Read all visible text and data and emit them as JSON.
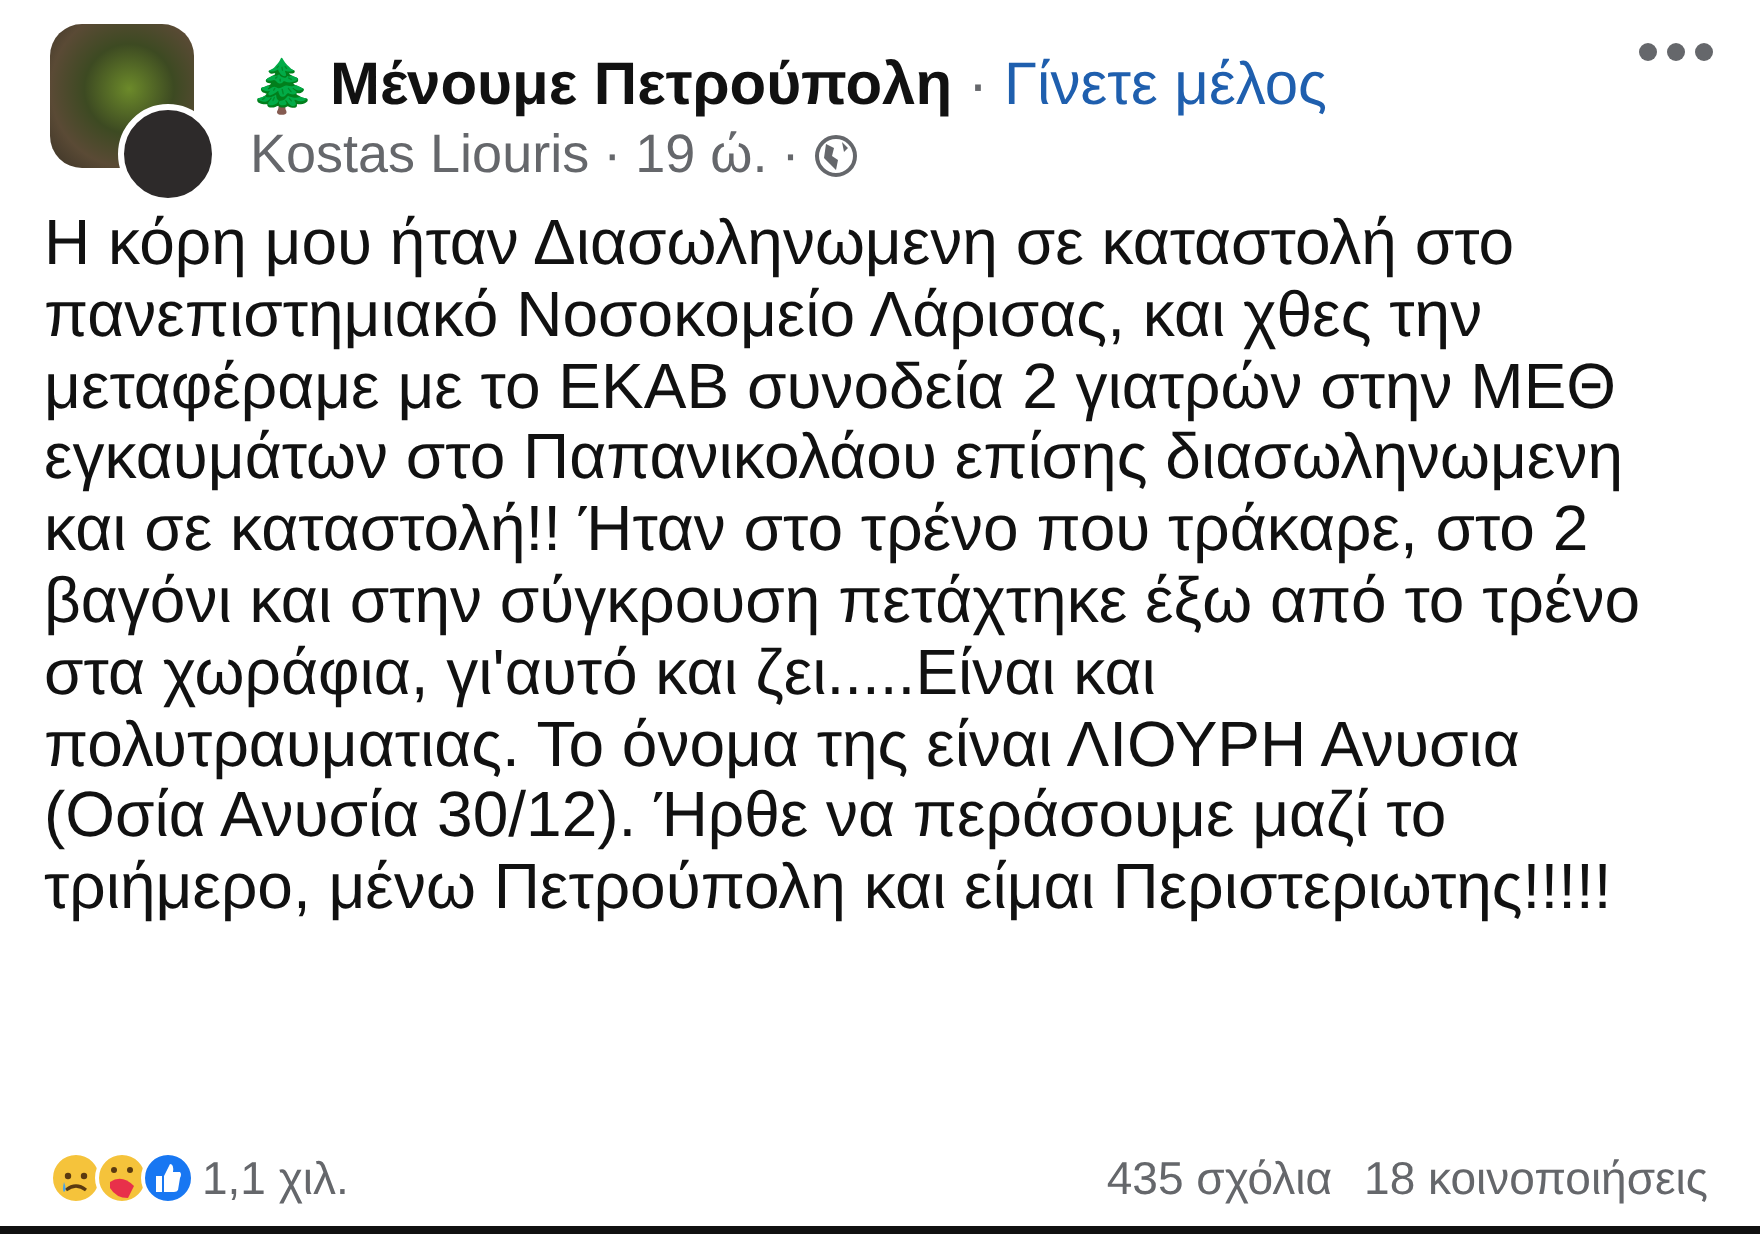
{
  "post": {
    "group_icon": "🌲",
    "group_name": "Μένουμε Πετρούπολη",
    "separator": "·",
    "join_link": "Γίνετε μέλος",
    "author": "Kostas Liouris",
    "time": "19 ώ.",
    "time_separator": "·",
    "body_lines": [
      "Η κόρη μου ήταν Διασωληνωμενη σε καταστολή στο",
      "πανεπιστημιακό Νοσοκομείο Λάρισας, και χθες την",
      "μεταφέραμε με το ΕΚΑΒ συνοδεία 2 γιατρών στην ΜΕΘ",
      "εγκαυμάτων στο Παπανικολάου επίσης διασωληνωμενη",
      "και σε καταστολή!! Ήταν στο τρένο που τράκαρε, στο 2",
      "βαγόνι και στην σύγκρουση πετάχτηκε έξω από το τρένο",
      "στα χωράφια, γι'αυτό και ζει.....Είναι και",
      "πολυτραυματιας. Το όνομα της είναι ΛΙΟΥΡΗ Ανυσια",
      "(Οσία Ανυσία 30/12). Ήρθε να περάσουμε μαζί το",
      "τριήμερο, μένω Πετρούπολη και είμαι Περιστεριωτης!!!!!"
    ],
    "reactions": "1,1 χιλ.",
    "comments": "435 σχόλια",
    "shares": "18 κοινοποιήσεις"
  }
}
